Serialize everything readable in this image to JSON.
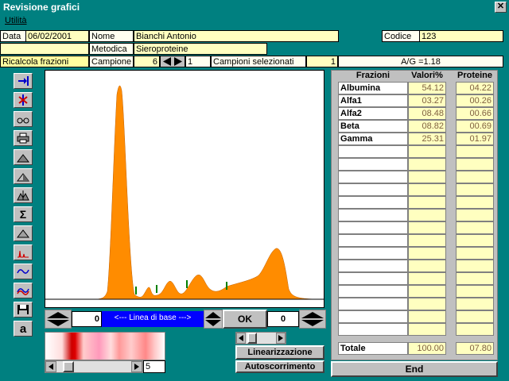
{
  "window": {
    "title": "Revisione grafici",
    "close": "✕"
  },
  "menu": {
    "utility": "Utilità"
  },
  "header": {
    "data_label": "Data",
    "data_value": "06/02/2001",
    "nome_label": "Nome",
    "nome_value": "Bianchi Antonio",
    "codice_label": "Codice",
    "codice_value": "123",
    "metodica_label": "Metodica",
    "metodica_value": "Sieroproteine",
    "ricalcola_label": "Ricalcola frazioni",
    "campione_label": "Campione",
    "campione_value": "6",
    "campione_index": "1",
    "selezionati_label": "Campioni selezionati",
    "selezionati_value": "1",
    "ag_ratio": "A/G =1.18"
  },
  "table": {
    "headers": [
      "Frazioni",
      "Valori%",
      "Proteine"
    ],
    "rows": [
      {
        "name": "Albumina",
        "val": "54.12",
        "prot": "04.22"
      },
      {
        "name": "Alfa1",
        "val": "03.27",
        "prot": "00.26"
      },
      {
        "name": "Alfa2",
        "val": "08.48",
        "prot": "00.66"
      },
      {
        "name": "Beta",
        "val": "08.82",
        "prot": "00.69"
      },
      {
        "name": "Gamma",
        "val": "25.31",
        "prot": "01.97"
      }
    ],
    "totale_label": "Totale",
    "totale_val": "100.00",
    "totale_prot": "07.80"
  },
  "baseline": {
    "left_value": "0",
    "label": "<---  Linea di base  --->",
    "ok": "OK",
    "right_value": "0"
  },
  "bottom": {
    "scroll_value": "5",
    "linearizzazione": "Linearizzazione",
    "autoscorrimento": "Autoscorrimento",
    "end": "End"
  },
  "colors": {
    "curve": "#ff8c00",
    "accent_blue": "#0000ff",
    "teal": "#008080"
  }
}
